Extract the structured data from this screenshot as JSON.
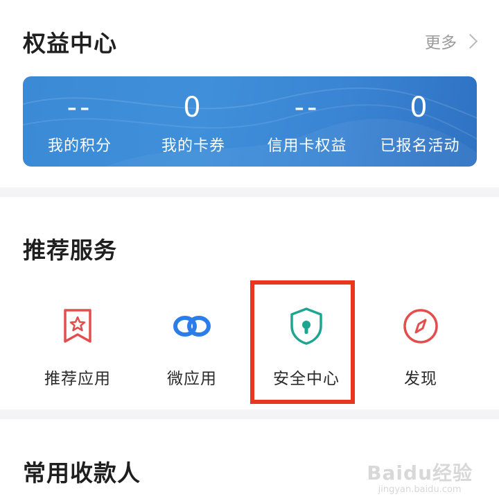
{
  "benefits": {
    "title": "权益中心",
    "more_label": "更多",
    "items": [
      {
        "value": "--",
        "label": "我的积分"
      },
      {
        "value": "0",
        "label": "我的卡券"
      },
      {
        "value": "--",
        "label": "信用卡权益"
      },
      {
        "value": "0",
        "label": "已报名活动"
      }
    ],
    "card_color": "#3b8ad6"
  },
  "services": {
    "title": "推荐服务",
    "items": [
      {
        "label": "推荐应用",
        "icon": "bookmark-star-icon",
        "color": "#e34d4d"
      },
      {
        "label": "微应用",
        "icon": "link-icon",
        "color": "#2b7de9"
      },
      {
        "label": "安全中心",
        "icon": "shield-lock-icon",
        "color": "#1ea591"
      },
      {
        "label": "发现",
        "icon": "compass-icon",
        "color": "#e34d4d"
      }
    ],
    "highlight_color": "#e8361f"
  },
  "payees": {
    "title": "常用收款人"
  },
  "watermark": {
    "main": "Baidu经验",
    "sub": "jingyan.baidu.com"
  }
}
